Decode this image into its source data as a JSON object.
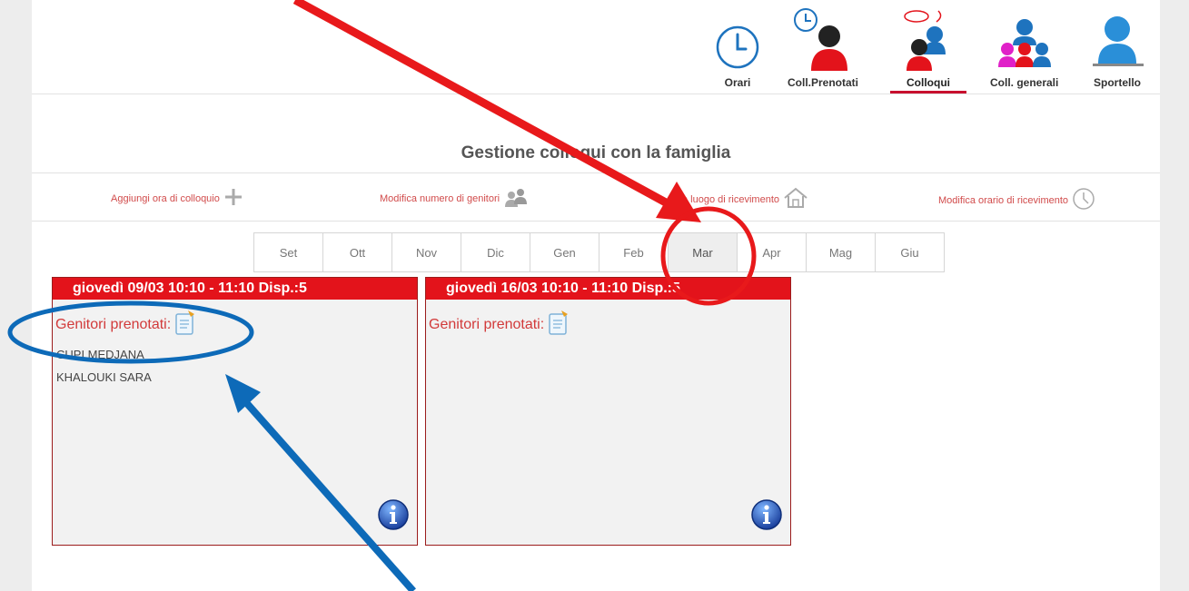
{
  "nav": {
    "items": [
      {
        "label": "Orari"
      },
      {
        "label": "Coll.Prenotati"
      },
      {
        "label": "Colloqui"
      },
      {
        "label": "Coll. generali"
      },
      {
        "label": "Sportello"
      }
    ],
    "active": "Colloqui"
  },
  "page_title": "Gestione colloqui con la famiglia",
  "actions": {
    "add_hour": "Aggiungi ora di colloquio",
    "edit_parents": "Modifica numero di genitori",
    "edit_place": "fica luogo di ricevimento",
    "edit_time": "Modifica orario di ricevimento"
  },
  "months": [
    "Set",
    "Ott",
    "Nov",
    "Dic",
    "Gen",
    "Feb",
    "Mar",
    "Apr",
    "Mag",
    "Giu"
  ],
  "selected_month": "Mar",
  "cards": [
    {
      "header": "giovedì 09/03 10:10 - 11:10 Disp.:5",
      "booked_label": "Genitori prenotati:",
      "parents": [
        "CUPI MEDJANA",
        "KHALOUKI SARA"
      ]
    },
    {
      "header": "giovedì 16/03 10:10 - 11:10 Disp.:5",
      "booked_label": "Genitori prenotati:",
      "parents": []
    }
  ],
  "colors": {
    "accent": "#e3131b",
    "annotation_red": "#e8191b",
    "annotation_blue": "#0d6ab8"
  }
}
